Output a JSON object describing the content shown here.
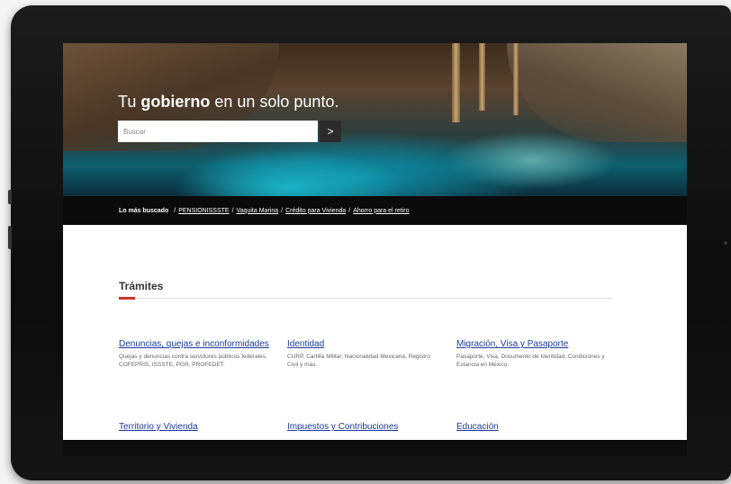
{
  "hero": {
    "title_bold_lead": "Tu ",
    "title_bold": "gobierno",
    "title_rest": " en un solo punto.",
    "search_placeholder": "Buscar",
    "search_button_glyph": ">"
  },
  "quicklinks": {
    "lead": "Lo más buscado",
    "separator": "/",
    "links": [
      "PENSIONISSSTE",
      "Vaquita Marina",
      "Crédito para Vivienda",
      "Ahorro para el retiro"
    ]
  },
  "tramites": {
    "title": "Trámites",
    "items": [
      {
        "title": "Denuncias, quejas e inconformidades",
        "desc": "Quejas y denuncias contra servidores públicos federales, COFEPRIS, ISSSTE, PGR, PROFEDET."
      },
      {
        "title": "Identidad",
        "desc": "CURP, Cartilla Militar, Nacionalidad Mexicana, Registro Civil y más."
      },
      {
        "title": "Migración, Visa y Pasaporte",
        "desc": "Pasaporte, Visa, Documento de Identidad, Condiciones y Estancia en México."
      },
      {
        "title": "Territorio y Vivienda",
        "desc": ""
      },
      {
        "title": "Impuestos y Contribuciones",
        "desc": ""
      },
      {
        "title": "Educación",
        "desc": ""
      }
    ]
  },
  "colors": {
    "accent": "#d0312d",
    "link": "#1a3a9a",
    "quicklinks_bg": "#0a0a0a"
  }
}
